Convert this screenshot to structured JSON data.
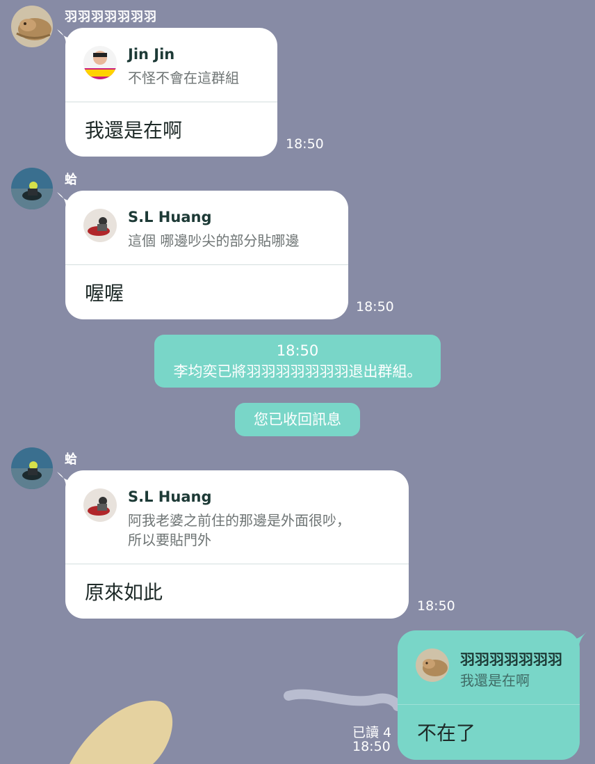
{
  "messages": [
    {
      "sender": "羽羽羽羽羽羽羽",
      "avatar_icon": "bearded-dragon-avatar",
      "quote": {
        "name": "Jin Jin",
        "text": "不怪不會在這群組"
      },
      "text": "我還是在啊",
      "time": "18:50"
    },
    {
      "sender": "蛤",
      "avatar_icon": "motorcycle-rider-avatar",
      "quote": {
        "name": "S.L Huang",
        "text": "這個 哪邊吵尖的部分貼哪邊"
      },
      "text": "喔喔",
      "time": "18:50"
    },
    {
      "sender": "蛤",
      "avatar_icon": "motorcycle-rider-avatar",
      "quote": {
        "name": "S.L Huang",
        "text": "阿我老婆之前住的那邊是外面很吵，\n所以要貼門外"
      },
      "text": "原來如此",
      "time": "18:50"
    }
  ],
  "system": {
    "time": "18:50",
    "left_notice": "李均奕已將羽羽羽羽羽羽羽退出群組。",
    "unsend_notice": "您已收回訊息"
  },
  "my_message": {
    "quote": {
      "name": "羽羽羽羽羽羽羽",
      "text": "我還是在啊"
    },
    "text": "不在了",
    "read": "已讀 4",
    "time": "18:50"
  },
  "colors": {
    "background": "#878ba5",
    "my_bubble": "#79d6c8",
    "their_bubble": "#ffffff"
  }
}
